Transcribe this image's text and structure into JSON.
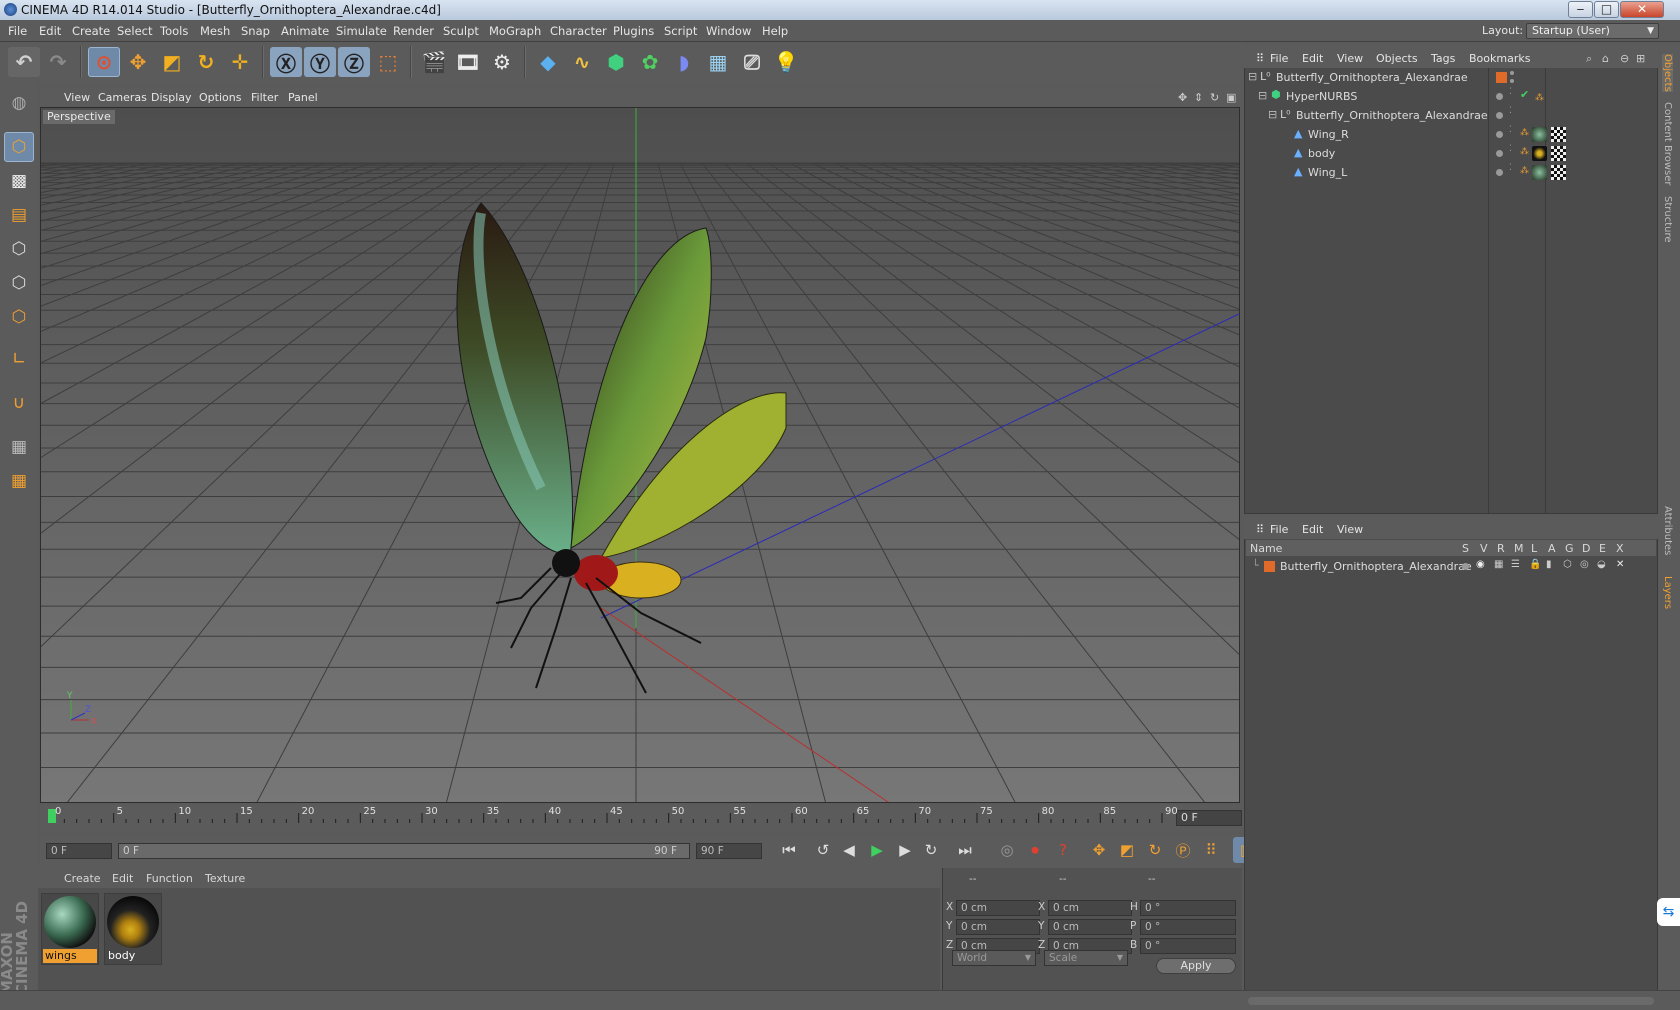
{
  "window": {
    "title": "CINEMA 4D R14.014 Studio - [Butterfly_Ornithoptera_Alexandrae.c4d]",
    "min": "‒",
    "max": "□",
    "close": "✕"
  },
  "menubar": {
    "items": [
      "File",
      "Edit",
      "Create",
      "Select",
      "Tools",
      "Mesh",
      "Snap",
      "Animate",
      "Simulate",
      "Render",
      "Sculpt",
      "MoGraph",
      "Character",
      "Plugins",
      "Script",
      "Window",
      "Help"
    ],
    "layout_label": "Layout:",
    "layout_value": "Startup (User)"
  },
  "viewport": {
    "menu": [
      "View",
      "Cameras",
      "Display",
      "Options",
      "Filter",
      "Panel"
    ],
    "label": "Perspective"
  },
  "timeline": {
    "ticks": [
      "0",
      "5",
      "10",
      "15",
      "20",
      "25",
      "30",
      "35",
      "40",
      "45",
      "50",
      "55",
      "60",
      "65",
      "70",
      "75",
      "80",
      "85",
      "90"
    ],
    "frame": "0 F"
  },
  "transport": {
    "start": "0 F",
    "range_start": "0 F",
    "range_end": "90 F",
    "end": "90 F"
  },
  "materials": {
    "menu": [
      "Create",
      "Edit",
      "Function",
      "Texture"
    ],
    "items": [
      {
        "name": "wings"
      },
      {
        "name": "body"
      }
    ]
  },
  "coords": {
    "header": [
      "--",
      "--",
      "--"
    ],
    "rows": [
      {
        "a": "X",
        "av": "0 cm",
        "b": "X",
        "bv": "0 cm",
        "c": "H",
        "cv": "0 °"
      },
      {
        "a": "Y",
        "av": "0 cm",
        "b": "Y",
        "bv": "0 cm",
        "c": "P",
        "cv": "0 °"
      },
      {
        "a": "Z",
        "av": "0 cm",
        "b": "Z",
        "bv": "0 cm",
        "c": "B",
        "cv": "0 °"
      }
    ],
    "world": "World",
    "scale": "Scale",
    "apply": "Apply"
  },
  "objects": {
    "menu": [
      "File",
      "Edit",
      "View",
      "Objects",
      "Tags",
      "Bookmarks"
    ],
    "tree": [
      {
        "name": "Butterfly_Ornithoptera_Alexandrae"
      },
      {
        "name": "HyperNURBS"
      },
      {
        "name": "Butterfly_Ornithoptera_Alexandrae"
      },
      {
        "name": "Wing_R"
      },
      {
        "name": "body"
      },
      {
        "name": "Wing_L"
      }
    ]
  },
  "layers": {
    "menu": [
      "File",
      "Edit",
      "View"
    ],
    "columns": [
      "Name",
      "S",
      "V",
      "R",
      "M",
      "L",
      "A",
      "G",
      "D",
      "E",
      "X"
    ],
    "rows": [
      {
        "name": "Butterfly_Ornithoptera_Alexandrae"
      }
    ]
  },
  "right_tabs": [
    "Objects",
    "Content Browser",
    "Structure",
    "Attributes",
    "Layers"
  ],
  "brand": "MAXON CINEMA 4D",
  "colors": {
    "accent": "#f0a030",
    "layer": "#e06a2a"
  }
}
